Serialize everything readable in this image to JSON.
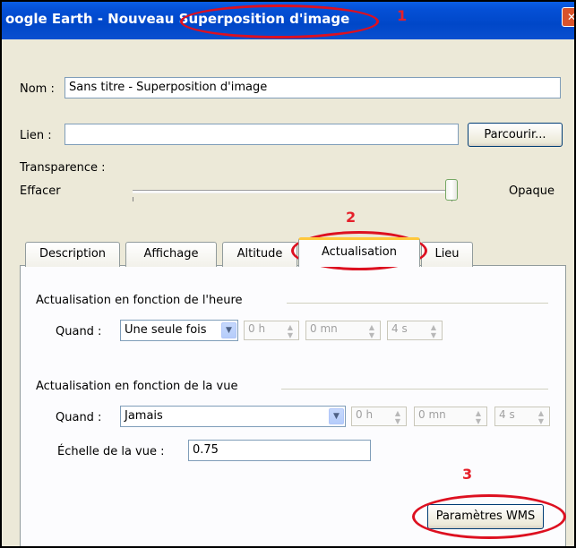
{
  "window": {
    "title": "oogle Earth - Nouveau Superposition d'image",
    "close_glyph": "✕"
  },
  "form": {
    "name_label": "Nom :",
    "name_value": "Sans titre - Superposition d'image",
    "link_label": "Lien :",
    "link_value": "",
    "browse_button": "Parcourir...",
    "transparency_label": "Transparence :",
    "slider_min_label": "Effacer",
    "slider_max_label": "Opaque",
    "transparency_level": 1.0
  },
  "tabs": [
    {
      "label": "Description"
    },
    {
      "label": "Affichage"
    },
    {
      "label": "Altitude"
    },
    {
      "label": "Actualisation",
      "active": true
    },
    {
      "label": "Lieu"
    }
  ],
  "refresh_time": {
    "group_title": "Actualisation en fonction de l'heure",
    "when_label": "Quand :",
    "when_value": "Une seule fois",
    "hours": "0 h",
    "minutes": "0 mn",
    "seconds": "4 s"
  },
  "refresh_view": {
    "group_title": "Actualisation en fonction de la vue",
    "when_label": "Quand :",
    "when_value": "Jamais",
    "hours": "0 h",
    "minutes": "0 mn",
    "seconds": "4 s",
    "scale_label": "Échelle de la vue :",
    "scale_value": "0.75"
  },
  "wms_button": "Paramètres WMS",
  "annotations": {
    "marker_1": "1",
    "marker_2": "2",
    "marker_3": "3",
    "color": "#dd1020"
  },
  "icons": {
    "dropdown": "chevron-down-icon",
    "spinner": "spin-up-down-icon",
    "close": "close-icon"
  }
}
